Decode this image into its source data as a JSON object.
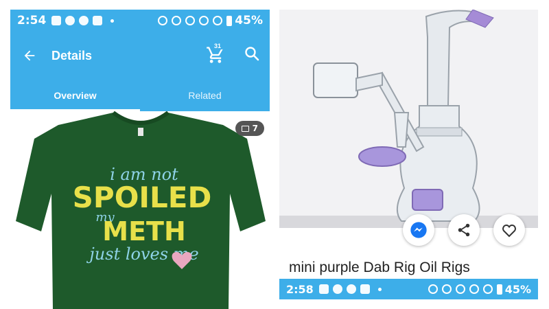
{
  "left": {
    "status": {
      "time": "2:54",
      "battery": "45%"
    },
    "appbar": {
      "title": "Details",
      "cart_count": "31"
    },
    "tabs": [
      {
        "label": "Overview",
        "active": true
      },
      {
        "label": "Related",
        "active": false
      }
    ],
    "product": {
      "photo_count": "7",
      "shirt_text": [
        "i am not",
        "SPOILED",
        "my",
        "METH",
        "just loves me"
      ],
      "shirt_color": "#1e5a2b"
    }
  },
  "right": {
    "title": "mini purple Dab Rig Oil Rigs",
    "status": {
      "time": "2:58",
      "battery": "45%"
    },
    "actions": [
      "messenger-icon",
      "share-icon",
      "heart-icon"
    ]
  },
  "colors": {
    "accent": "#3daee9"
  }
}
